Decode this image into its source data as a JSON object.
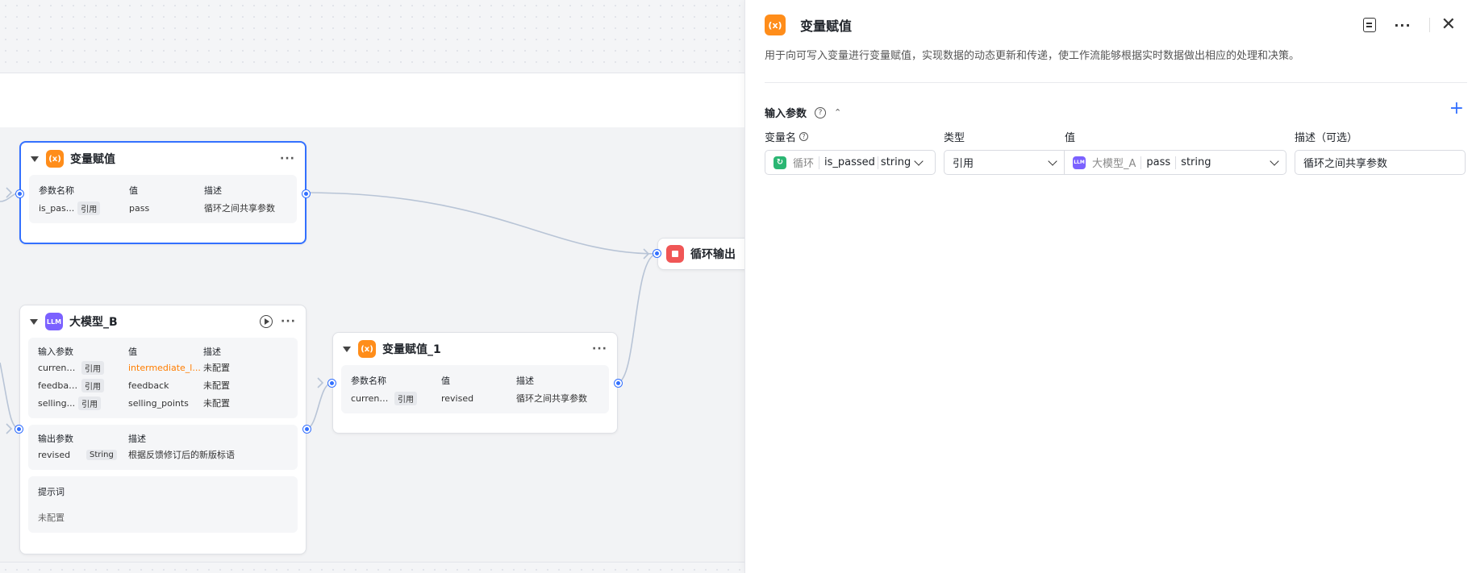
{
  "canvas": {
    "node_assign": {
      "title": "变量赋值",
      "icon": "variable-icon",
      "icon_text": "(x)",
      "headers": [
        "参数名称",
        "值",
        "描述"
      ],
      "rows": [
        {
          "name": "is_pas...",
          "tag": "引用",
          "value": "pass",
          "desc": "循环之间共享参数"
        }
      ]
    },
    "node_llm": {
      "title": "大模型_B",
      "icon_text": "LLM",
      "input_headers": [
        "输入参数",
        "值",
        "描述"
      ],
      "inputs": [
        {
          "name": "current...",
          "tag": "引用",
          "value": "intermediate_l...",
          "desc": "未配置"
        },
        {
          "name": "feedback",
          "tag": "引用",
          "value": "feedback",
          "desc": "未配置"
        },
        {
          "name": "selling...",
          "tag": "引用",
          "value": "selling_points",
          "desc": "未配置"
        }
      ],
      "output_headers": [
        "输出参数",
        "描述"
      ],
      "outputs": [
        {
          "name": "revised",
          "type": "String",
          "desc": "根据反馈修订后的新版标语"
        }
      ],
      "prompt_label": "提示词",
      "prompt_value": "未配置"
    },
    "node_assign_1": {
      "title": "变量赋值_1",
      "icon_text": "(x)",
      "headers": [
        "参数名称",
        "值",
        "描述"
      ],
      "rows": [
        {
          "name": "current...",
          "tag": "引用",
          "value": "revised",
          "desc": "循环之间共享参数"
        }
      ]
    },
    "node_output": {
      "title": "循环输出"
    }
  },
  "panel": {
    "icon_text": "(x)",
    "title": "变量赋值",
    "description": "用于向可写入变量进行变量赋值，实现数据的动态更新和传递，使工作流能够根据实时数据做出相应的处理和决策。",
    "section_title": "输入参数",
    "columns": {
      "name": "变量名",
      "type": "类型",
      "value": "值",
      "desc": "描述（可选）"
    },
    "row": {
      "name_source": "循环",
      "name_var": "is_passed",
      "name_type": "string",
      "type_value": "引用",
      "value_source": "大模型_A",
      "value_var": "pass",
      "value_type": "string",
      "desc_value": "循环之间共享参数"
    }
  }
}
